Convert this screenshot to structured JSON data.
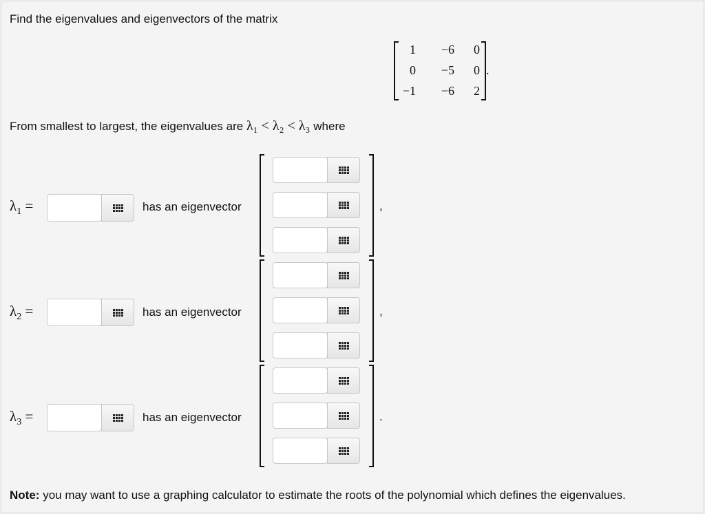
{
  "prompt": "Find the eigenvalues and eigenvectors of the matrix",
  "matrix": {
    "rows": [
      [
        "1",
        "−6",
        "0"
      ],
      [
        "0",
        "−5",
        "0"
      ],
      [
        "−1",
        "−6",
        "2"
      ]
    ],
    "trailing": "."
  },
  "eigen_intro": "From smallest to largest, the eigenvalues are",
  "eigen_order": "λ₁ < λ₂ < λ₃",
  "eigen_where": "where",
  "rows": [
    {
      "lambda": "λ",
      "sub": "1",
      "eq": "=",
      "value": "",
      "has_text": "has an eigenvector",
      "vector": [
        "",
        "",
        ""
      ],
      "punct": ","
    },
    {
      "lambda": "λ",
      "sub": "2",
      "eq": "=",
      "value": "",
      "has_text": "has an eigenvector",
      "vector": [
        "",
        "",
        ""
      ],
      "punct": ","
    },
    {
      "lambda": "λ",
      "sub": "3",
      "eq": "=",
      "value": "",
      "has_text": "has an eigenvector",
      "vector": [
        "",
        "",
        ""
      ],
      "punct": "."
    }
  ],
  "note_bold": "Note:",
  "note_text": "you may want to use a graphing calculator to estimate the roots of the polynomial which defines the eigenvalues.",
  "icons": {
    "calculator": "grid-icon"
  }
}
